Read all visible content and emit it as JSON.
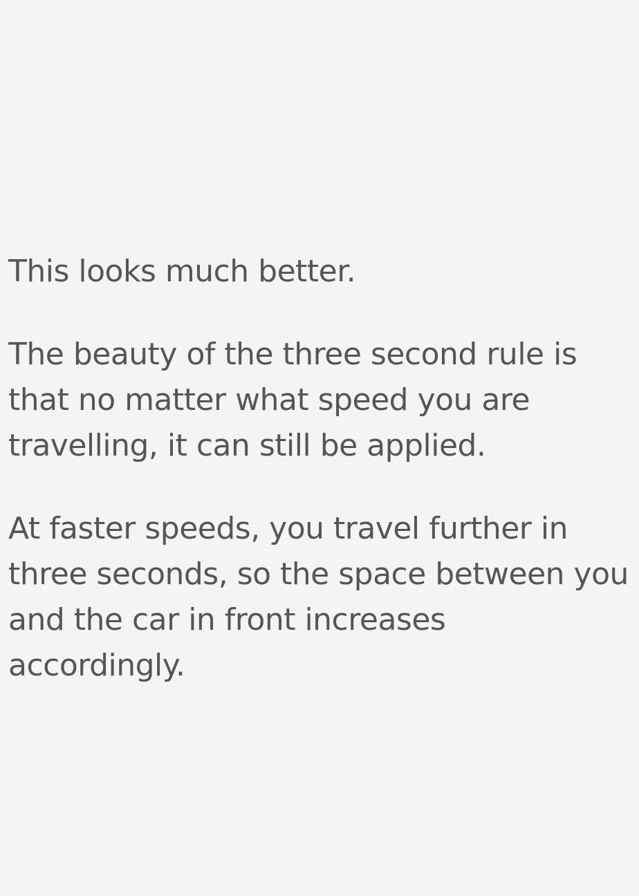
{
  "paragraphs": [
    "This looks much better.",
    "The beauty of the three second rule is\nthat no matter what speed you are\ntravelling, it can still be applied.",
    "At faster speeds, you travel further in\nthree seconds, so the space between you\nand the car in front increases accordingly."
  ],
  "colors": {
    "background": "#f4f4f4",
    "text": "#555555"
  }
}
